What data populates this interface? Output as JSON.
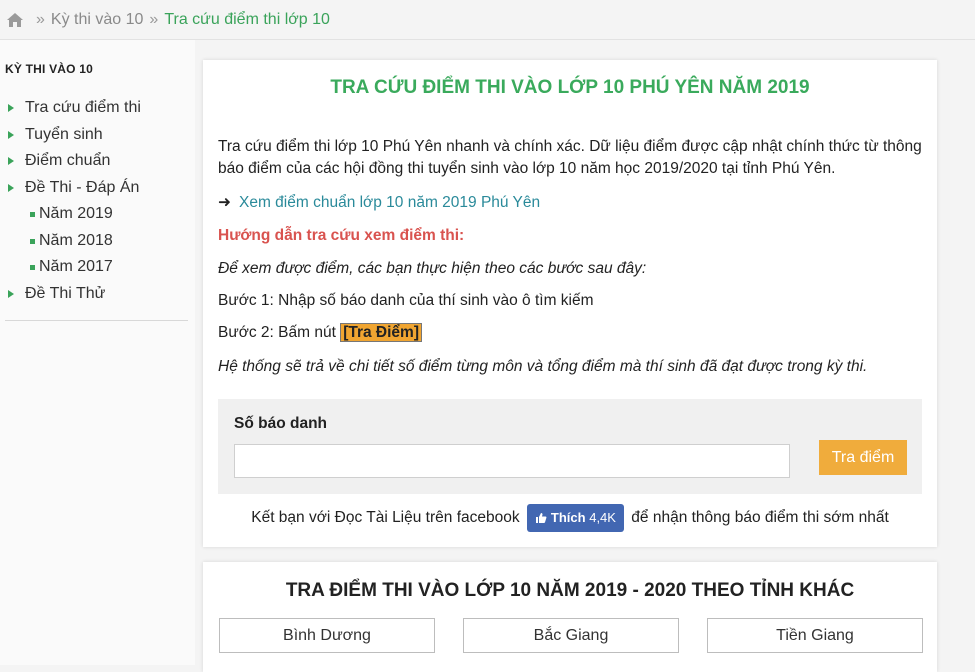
{
  "breadcrumb": {
    "icon": "home-icon",
    "items": [
      "Kỳ thi vào 10",
      "Tra cứu điểm thi lớp 10"
    ],
    "separator": "»"
  },
  "sidebar": {
    "heading": "KỲ THI VÀO 10",
    "items": [
      {
        "label": "Tra cứu điểm thi",
        "level": 1
      },
      {
        "label": "Tuyển sinh",
        "level": 1
      },
      {
        "label": "Điểm chuẩn",
        "level": 1
      },
      {
        "label": "Đề Thi - Đáp Án",
        "level": 1
      },
      {
        "label": "Năm 2019",
        "level": 2
      },
      {
        "label": "Năm 2018",
        "level": 2
      },
      {
        "label": "Năm 2017",
        "level": 2
      },
      {
        "label": "Đề Thi Thử",
        "level": 1
      }
    ]
  },
  "main": {
    "title": "TRA CỨU ĐIỂM THI VÀO LỚP 10 PHÚ YÊN NĂM 2019",
    "intro": "Tra cứu điểm thi lớp 10 Phú Yên nhanh và chính xác. Dữ liệu điểm được cập nhật chính thức từ thông báo điểm của các hội đồng thi tuyển sinh vào lớp 10 năm học 2019/2020 tại tỉnh Phú Yên.",
    "link_arrow": "➜",
    "link_text": "Xem điểm chuẩn lớp 10 năm 2019 Phú Yên",
    "guide_title": "Hướng dẫn tra cứu xem điểm thi:",
    "steps_intro": "Để xem được điểm, các bạn thực hiện theo các bước sau đây:",
    "step1": "Bước 1: Nhập số báo danh của thí sinh vào ô tìm kiếm",
    "step2_prefix": "Bước 2: Bấm nút ",
    "step2_highlight": "[Tra Điểm]",
    "result_note": "Hệ thống sẽ trả về chi tiết số điểm từng môn và tổng điểm mà thí sinh đã đạt được trong kỳ thi."
  },
  "search": {
    "label": "Số báo danh",
    "value": "",
    "placeholder": "",
    "button_label": "Tra điểm"
  },
  "facebook": {
    "before": "Kết bạn với Đọc Tài Liệu trên facebook",
    "like_label": "Thích",
    "like_count": "4,4K",
    "after": "để nhận thông báo điểm thi sớm nhất"
  },
  "other_provinces": {
    "title": "TRA ĐIỂM THI VÀO LỚP 10 NĂM 2019 - 2020 THEO TỈNH KHÁC",
    "items": [
      "Bình Dương",
      "Bắc Giang",
      "Tiền Giang"
    ]
  },
  "colors": {
    "accent_green": "#3aaa5c",
    "guide_red": "#d9534f",
    "button_orange": "#f0ac3c",
    "facebook_blue": "#4267b2"
  }
}
